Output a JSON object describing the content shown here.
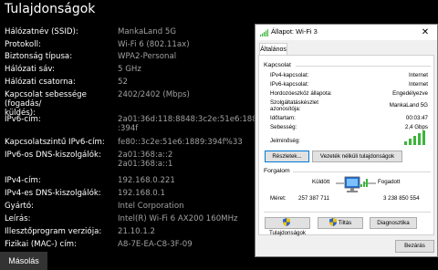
{
  "page": {
    "title": "Tulajdonságok",
    "copy_button": "Másolás"
  },
  "properties": [
    {
      "label": "Hálózatnév (SSID):",
      "value": "MankaLand 5G"
    },
    {
      "label": "Protokoll:",
      "value": "Wi-Fi 6 (802.11ax)"
    },
    {
      "label": "Biztonság típusa:",
      "value": "WPA2-Personal"
    },
    {
      "label": "Hálózati sáv:",
      "value": "5 GHz"
    },
    {
      "label": "Hálózati csatorna:",
      "value": "52"
    },
    {
      "label": "Kapcsolat sebessége (fogadás/\nküldés):",
      "value": "2402/2402 (Mbps)"
    },
    {
      "label": "IPv6-cím:",
      "value": "2a01:36d:118:8848:3c2e:51e6:1889\n:394f"
    },
    {
      "label": "Kapcsolatszintű IPv6-cím:",
      "value": "fe80::3c2e:51e6:1889:394f%33"
    },
    {
      "label": "IPv6-os DNS-kiszolgálók:",
      "value": "2a01:368:a::2\n2a01:368:a::1"
    },
    {
      "label": "IPv4-cím:",
      "value": "192.168.0.221"
    },
    {
      "label": "IPv4-es DNS-kiszolgálók:",
      "value": "192.168.0.1"
    },
    {
      "label": "Gyártó:",
      "value": "Intel Corporation"
    },
    {
      "label": "Leírás:",
      "value": "Intel(R) Wi-Fi 6 AX200 160MHz"
    },
    {
      "label": "Illesztőprogram verziója:",
      "value": "21.10.1.2"
    },
    {
      "label": "Fizikai (MAC-) cím:",
      "value": "A8-7E-EA-C8-3F-09"
    }
  ],
  "dialog": {
    "title": "Állapot: Wi-Fi 3",
    "close_glyph": "✕",
    "tab": "Általános",
    "connection": {
      "group_label": "Kapcsolat",
      "rows": [
        {
          "label": "IPv4-kapcsolat:",
          "value": "Internet"
        },
        {
          "label": "IPv6-kapcsolat:",
          "value": "Internet"
        },
        {
          "label": "Hordozóeszköz állapota:",
          "value": "Engedélyezve"
        },
        {
          "label": "Szolgáltatáskészlet\nazonosítója:",
          "value": "MankaLand 5G"
        },
        {
          "label": "Időtartam:",
          "value": "00:03:47"
        },
        {
          "label": "Sebesség:",
          "value": "2,4 Gbps"
        }
      ],
      "signal_label": "Jelminőség:",
      "signal_bars": 5,
      "details_button": "Részletek...",
      "wireless_button": "Vezeték nélküli tulajdonságok"
    },
    "traffic": {
      "group_label": "Forgalom",
      "sent_label": "Küldött",
      "received_label": "Fogadott",
      "bytes_label": "Méret:",
      "sent_value": "257 387 711",
      "received_value": "3 238 850 554"
    },
    "buttons": {
      "properties": "Tulajdonságok",
      "disable": "Tiltás",
      "diagnose": "Diagnosztika",
      "close": "Bezárás"
    }
  },
  "colors": {
    "signal": "#3cb43c",
    "accent": "#0078d7",
    "shield_blue": "#2a62c9",
    "shield_yellow": "#f2c200"
  }
}
